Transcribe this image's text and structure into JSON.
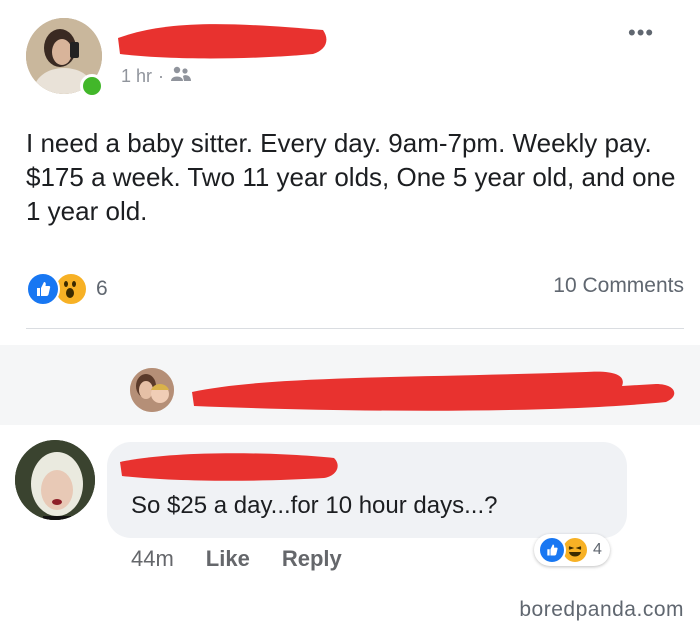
{
  "post": {
    "time": "1 hr",
    "dot": "·",
    "audience_icon": "friends-icon",
    "text": "I need a baby sitter. Every day. 9am-7pm. Weekly pay. $175 a week. Two 11 year olds, One 5 year old, and one 1 year old.",
    "reaction_count": "6",
    "comments_count": "10 Comments",
    "more": "•••"
  },
  "comment": {
    "text": "So $25 a day...for 10 hour days...?",
    "time": "44m",
    "like_label": "Like",
    "reply_label": "Reply",
    "reaction_count": "4"
  },
  "watermark": "boredpanda.com",
  "colors": {
    "redaction": "#e8322f",
    "like_blue": "#1877f2",
    "wow_yellow": "#f7b125",
    "online_green": "#42b72a"
  }
}
